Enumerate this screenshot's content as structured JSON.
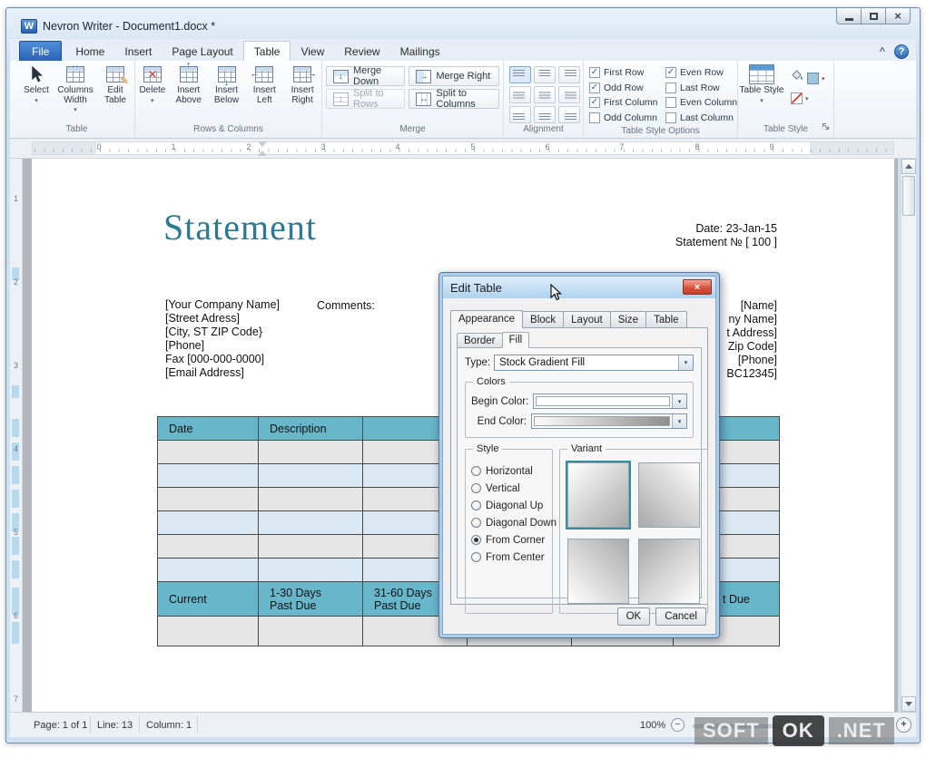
{
  "window": {
    "title": "Nevron Writer - Document1.docx *",
    "app_initial": "W"
  },
  "icons": {
    "close": "×",
    "dropdown": "▾",
    "help": "?",
    "collapse": "^",
    "zoom_out": "−",
    "zoom_in": "+",
    "arrow_up": "↑",
    "arrow_down": "↓",
    "arrow_left": "←",
    "arrow_right": "→",
    "arrow_lr": "↔",
    "arrow_ud": "↕",
    "delete_x": "✕",
    "pencil": "✎"
  },
  "ribbon": {
    "tabs": [
      {
        "label": "File"
      },
      {
        "label": "Home"
      },
      {
        "label": "Insert"
      },
      {
        "label": "Page Layout"
      },
      {
        "label": "Table"
      },
      {
        "label": "View"
      },
      {
        "label": "Review"
      },
      {
        "label": "Mailings"
      }
    ],
    "active_tab": "Table",
    "groups": {
      "table": {
        "label": "Table",
        "select": "Select",
        "columns_width": "Columns Width",
        "edit_table": "Edit Table"
      },
      "rows_columns": {
        "label": "Rows & Columns",
        "delete": "Delete",
        "insert_above": "Insert Above",
        "insert_below": "Insert Below",
        "insert_left": "Insert Left",
        "insert_right": "Insert Right"
      },
      "merge": {
        "label": "Merge",
        "merge_down": "Merge Down",
        "merge_right": "Merge Right",
        "split_to_rows": "Split to Rows",
        "split_to_columns": "Split to Columns"
      },
      "alignment": {
        "label": "Alignment"
      },
      "table_style_options": {
        "label": "Table Style Options",
        "options": [
          {
            "label": "First Row",
            "mark": "✓",
            "checked": true
          },
          {
            "label": "Odd Row",
            "mark": "✓",
            "checked": true
          },
          {
            "label": "First Column",
            "mark": "✓",
            "checked": true
          },
          {
            "label": "Odd Column",
            "mark": "",
            "checked": false
          },
          {
            "label": "Even Row",
            "mark": "✓",
            "checked": true
          },
          {
            "label": "Last Row",
            "mark": "",
            "checked": false
          },
          {
            "label": "Even Column",
            "mark": "",
            "checked": false
          },
          {
            "label": "Last Column",
            "mark": "",
            "checked": false
          }
        ]
      },
      "table_style": {
        "label": "Table Style",
        "button": "Table Style"
      }
    }
  },
  "ruler": {
    "horizontal": [
      "0",
      "1",
      "2",
      "3",
      "4",
      "5",
      "6",
      "7",
      "8",
      "9"
    ],
    "vertical": [
      "1",
      "2",
      "3",
      "4",
      "5",
      "6",
      "7"
    ]
  },
  "document": {
    "title": "Statement",
    "date_line": "Date: 23-Jan-15",
    "number_line": "Statement № [ 100 ]",
    "company_lines": [
      "[Your Company Name]",
      "[Street Adress]",
      "[City, ST ZIP Code}",
      "[Phone]",
      "Fax [000-000-0000]",
      "[Email Address]"
    ],
    "comments_label": "Comments:",
    "partial_right_lines": [
      "[Name]",
      "ny Name]",
      "t Address]",
      "Zip Code]",
      "[Phone]",
      "BC12345]"
    ],
    "table": {
      "header": [
        "Date",
        "Description"
      ],
      "footer": [
        "Current",
        "1-30 Days\nPast Due",
        "31-60 Days\nPast Due",
        "t Due"
      ]
    }
  },
  "dialog": {
    "title": "Edit Table",
    "tabs": [
      {
        "label": "Appearance",
        "active": true
      },
      {
        "label": "Block",
        "active": false
      },
      {
        "label": "Layout",
        "active": false
      },
      {
        "label": "Size",
        "active": false
      },
      {
        "label": "Table",
        "active": false
      }
    ],
    "subtabs": [
      {
        "label": "Border",
        "active": false
      },
      {
        "label": "Fill",
        "active": true
      }
    ],
    "type_label": "Type:",
    "type_value": "Stock Gradient Fill",
    "colors": {
      "legend": "Colors",
      "begin_label": "Begin Color:",
      "end_label": "End Color:"
    },
    "style": {
      "legend": "Style",
      "options": [
        {
          "label": "Horizontal",
          "selected": false
        },
        {
          "label": "Vertical",
          "selected": false
        },
        {
          "label": "Diagonal Up",
          "selected": false
        },
        {
          "label": "Diagonal Down",
          "selected": false
        },
        {
          "label": "From Corner",
          "selected": true
        },
        {
          "label": "From Center",
          "selected": false
        }
      ]
    },
    "variant_legend": "Variant",
    "ok": "OK",
    "cancel": "Cancel"
  },
  "status_bar": {
    "page": "Page: 1 of 1",
    "line": "Line: 13",
    "column": "Column: 1",
    "zoom": "100%"
  },
  "watermark": {
    "seg1": "SOFT",
    "seg2": "OK",
    "seg3": ".NET"
  },
  "colors": {
    "accent_blue": "#2a63b4",
    "table_header_teal": "#68b6ca",
    "row_alt_blue": "#d9e8f2",
    "row_alt_gray": "#e6e6e6",
    "title_teal": "#2c7a93",
    "close_red": "#d44f38",
    "variant_selected_border": "#2f8fa0"
  }
}
